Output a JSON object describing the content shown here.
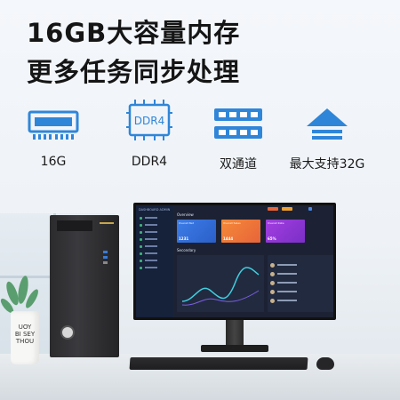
{
  "headline": {
    "line1": "16GB大容量内存",
    "line2": "更多任务同步处理"
  },
  "features": [
    {
      "icon": "ram-module-icon",
      "label": "16G"
    },
    {
      "icon": "ddr4-chip-icon",
      "label": "DDR4",
      "chip_text": "DDR4"
    },
    {
      "icon": "dual-channel-icon",
      "label": "双通道"
    },
    {
      "icon": "upgrade-arrow-icon",
      "label": "最大支持32G"
    }
  ],
  "colors": {
    "accent": "#2f86d9",
    "headline": "#151515",
    "screen_bg": "#1c2233"
  },
  "screen": {
    "brand": "DASHBOARD ADMIN",
    "overview": "Overview",
    "secondary": "Secondary",
    "cards": [
      {
        "label": "Overall Net",
        "value": "1231"
      },
      {
        "label": "Overall Sales",
        "value": "1444"
      },
      {
        "label": "Overall Rate",
        "value": "65%"
      }
    ]
  },
  "cup": {
    "text": [
      "UOY",
      "BI SEY",
      "THOU"
    ]
  }
}
